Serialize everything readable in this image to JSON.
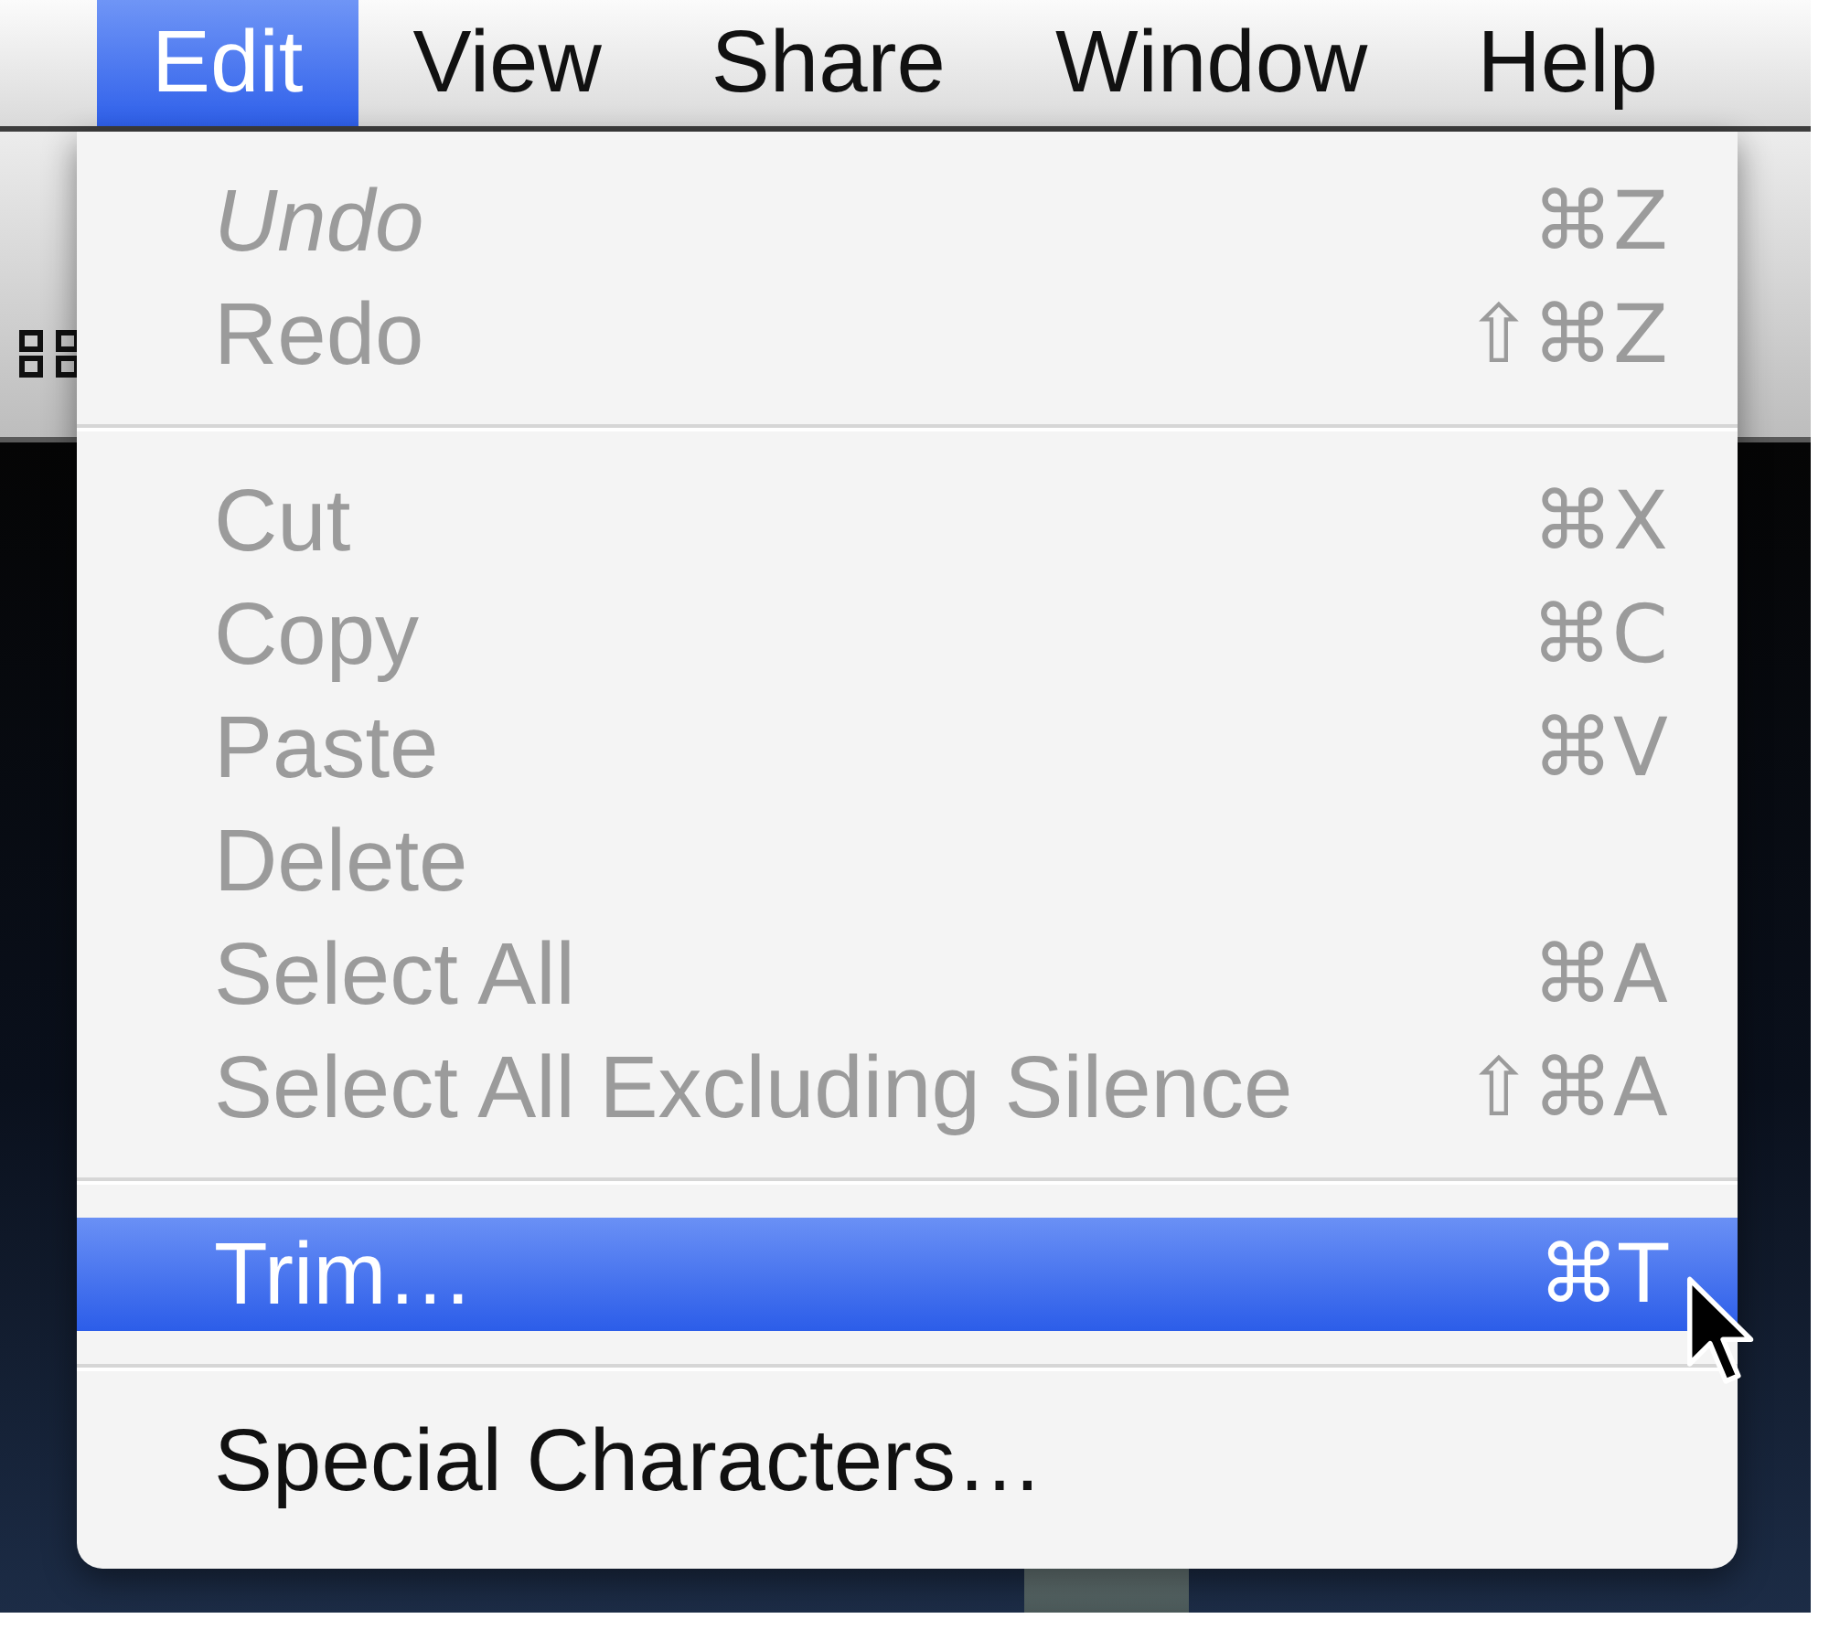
{
  "menu_bar": {
    "items": [
      {
        "label": "Edit",
        "selected": true
      },
      {
        "label": "View",
        "selected": false
      },
      {
        "label": "Share",
        "selected": false
      },
      {
        "label": "Window",
        "selected": false
      },
      {
        "label": "Help",
        "selected": false
      }
    ]
  },
  "edit_menu": {
    "groups": [
      {
        "items": [
          {
            "label": "Undo",
            "shortcut": "⌘Z",
            "disabled": true,
            "italic": true,
            "selected": false
          },
          {
            "label": "Redo",
            "shortcut": "⇧⌘Z",
            "disabled": true,
            "italic": false,
            "selected": false
          }
        ]
      },
      {
        "items": [
          {
            "label": "Cut",
            "shortcut": "⌘X",
            "disabled": true,
            "italic": false,
            "selected": false
          },
          {
            "label": "Copy",
            "shortcut": "⌘C",
            "disabled": true,
            "italic": false,
            "selected": false
          },
          {
            "label": "Paste",
            "shortcut": "⌘V",
            "disabled": true,
            "italic": false,
            "selected": false
          },
          {
            "label": "Delete",
            "disabled": true,
            "italic": false,
            "selected": false
          },
          {
            "label": "Select All",
            "shortcut": "⌘A",
            "disabled": true,
            "italic": false,
            "selected": false
          },
          {
            "label": "Select All Excluding Silence",
            "shortcut": "⇧⌘A",
            "disabled": true,
            "italic": false,
            "selected": false
          }
        ]
      },
      {
        "items": [
          {
            "label": "Trim…",
            "shortcut": "⌘T",
            "disabled": false,
            "italic": false,
            "selected": true
          }
        ]
      },
      {
        "items": [
          {
            "label": "Special Characters…",
            "disabled": false,
            "italic": false,
            "selected": false
          }
        ]
      }
    ]
  }
}
